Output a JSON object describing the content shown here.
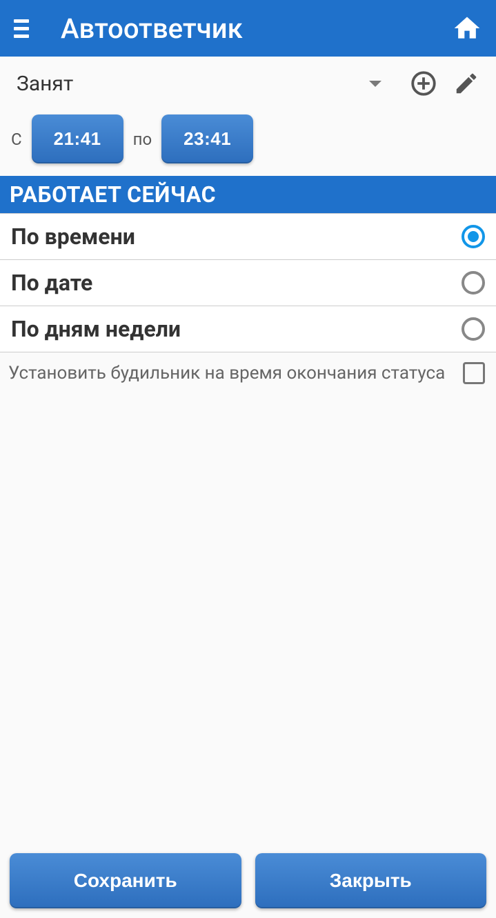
{
  "header": {
    "title": "Автоответчик"
  },
  "status_dropdown": {
    "selected": "Занят"
  },
  "time": {
    "from_label": "С",
    "from_value": "21:41",
    "to_label": "по",
    "to_value": "23:41"
  },
  "section_title": "РАБОТАЕТ СЕЙЧАС",
  "options": [
    {
      "label": "По времени",
      "checked": true
    },
    {
      "label": "По дате",
      "checked": false
    },
    {
      "label": "По дням недели",
      "checked": false
    }
  ],
  "alarm": {
    "label": "Установить будильник на время окончания статуса",
    "checked": false
  },
  "footer": {
    "save": "Сохранить",
    "close": "Закрыть"
  }
}
